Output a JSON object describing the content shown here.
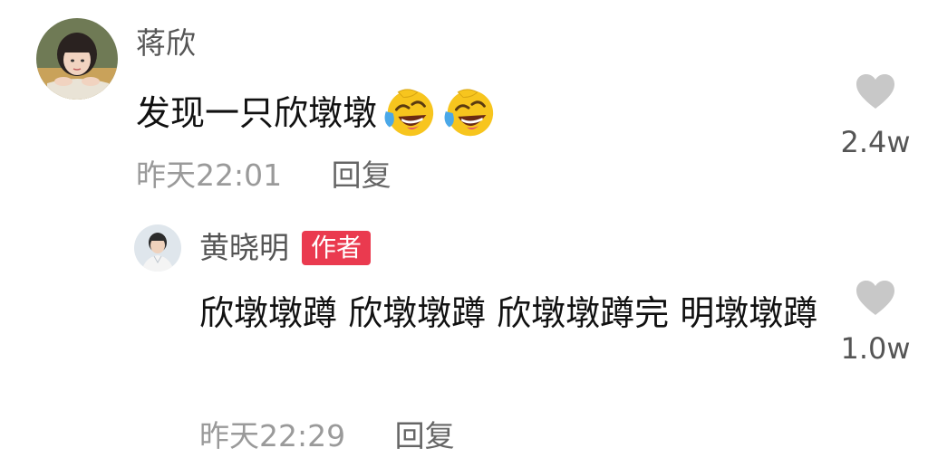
{
  "comment": {
    "username": "蒋欣",
    "content": "发现一只欣墩墩",
    "emojis": [
      "laughing-crying-emoji",
      "laughing-crying-emoji"
    ],
    "timestamp": "昨天22:01",
    "reply_label": "回复",
    "like_count": "2.4w",
    "like_icon": "heart-icon",
    "like_color": "#c8c8c8"
  },
  "reply": {
    "username": "黄晓明",
    "badge": "作者",
    "badge_color": "#ea3a4f",
    "content": "欣墩墩蹲 欣墩墩蹲 欣墩墩蹲完 明墩墩蹲",
    "timestamp": "昨天22:29",
    "reply_label": "回复",
    "like_count": "1.0w",
    "like_icon": "heart-icon"
  }
}
